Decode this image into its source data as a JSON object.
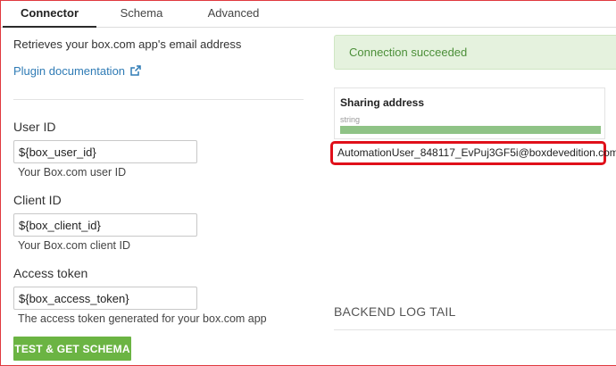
{
  "tabs": [
    {
      "label": "Connector",
      "active": true
    },
    {
      "label": "Schema",
      "active": false
    },
    {
      "label": "Advanced",
      "active": false
    }
  ],
  "connector": {
    "description": "Retrieves your box.com app's email address",
    "doc_link": "Plugin documentation",
    "doc_link_icon": "external-link-icon",
    "fields": [
      {
        "label": "User ID",
        "value": "${box_user_id}",
        "help": "Your Box.com user ID"
      },
      {
        "label": "Client ID",
        "value": "${box_client_id}",
        "help": "Your Box.com client ID"
      },
      {
        "label": "Access token",
        "value": "${box_access_token}",
        "help": "The access token generated for your box.com app"
      }
    ],
    "test_button": "TEST & GET SCHEMA"
  },
  "result": {
    "status": "Connection succeeded",
    "column_name": "Sharing address",
    "column_type": "string",
    "value": "AutomationUser_848117_EvPuj3GF5i@boxdevedition.com"
  },
  "log": {
    "title": "BACKEND LOG TAIL"
  },
  "colors": {
    "accent_link": "#2f7bb5",
    "success_bg": "#e5f2de",
    "success_text": "#4c8f39",
    "button_green": "#6bb443",
    "highlight_red": "#e0101a"
  }
}
